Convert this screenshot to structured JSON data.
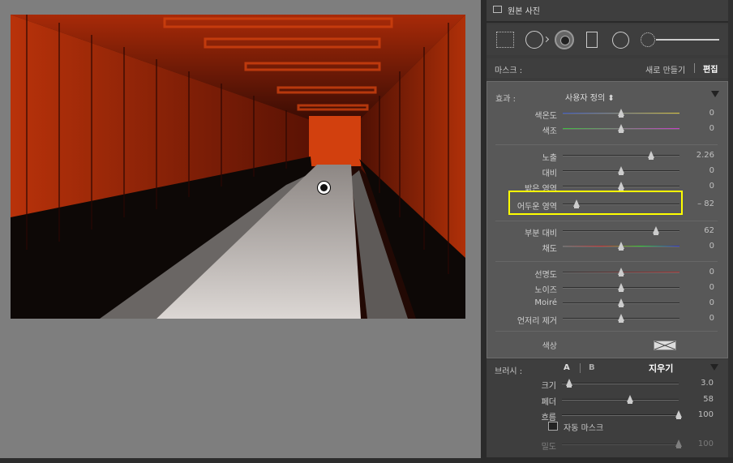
{
  "panel": {
    "original_photo_label": "원본 사진",
    "mask_label": "마스크 :",
    "mask_new": "새로 만들기",
    "mask_edit": "편집",
    "effect_label": "효과 :",
    "effect_value": "사용자 정의 ⬍",
    "color_label": "색상"
  },
  "sliders": [
    {
      "label": "색온도",
      "value": "0",
      "pos": 0.5,
      "gradient": "linear-gradient(90deg,#3a59c8,#d6c23a)"
    },
    {
      "label": "색조",
      "value": "0",
      "pos": 0.5,
      "gradient": "linear-gradient(90deg,#3fbf3f,#c83fc8)"
    },
    {
      "label": "노출",
      "value": "2.26",
      "pos": 0.76
    },
    {
      "label": "대비",
      "value": "0",
      "pos": 0.5
    },
    {
      "label": "밝은 영역",
      "value": "0",
      "pos": 0.5
    },
    {
      "label": "어두운 영역",
      "value": "– 82",
      "pos": 0.12
    },
    {
      "label": "부분 대비",
      "value": "62",
      "pos": 0.8
    },
    {
      "label": "채도",
      "value": "0",
      "pos": 0.5,
      "gradient": "linear-gradient(90deg,#777,#c33,#3c3,#33c)"
    },
    {
      "label": "선명도",
      "value": "0",
      "pos": 0.5,
      "gradient": "linear-gradient(90deg,#333,#a33)"
    },
    {
      "label": "노이즈",
      "value": "0",
      "pos": 0.5
    },
    {
      "label": "Moiré",
      "value": "0",
      "pos": 0.5
    },
    {
      "label": "언저리 제거",
      "value": "0",
      "pos": 0.5
    }
  ],
  "brush": {
    "label": "브러시 :",
    "a": "A",
    "b": "B",
    "erase": "지우기",
    "auto_mask": "자동 마스크",
    "sliders": [
      {
        "label": "크기",
        "value": "3.0",
        "pos": 0.06
      },
      {
        "label": "페더",
        "value": "58",
        "pos": 0.58
      },
      {
        "label": "흐름",
        "value": "100",
        "pos": 1.0
      },
      {
        "label": "밀도",
        "value": "100",
        "pos": 1.0
      }
    ]
  }
}
